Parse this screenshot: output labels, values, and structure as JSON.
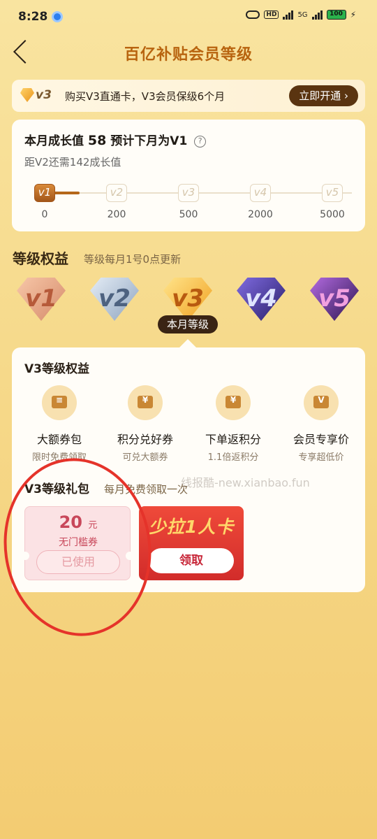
{
  "status_bar": {
    "time": "8:28",
    "hd": "HD",
    "network": "5G",
    "battery": "100"
  },
  "header": {
    "title": "百亿补贴会员等级"
  },
  "promo": {
    "badge": "v3",
    "text": "购买V3直通卡，V3会员保级6个月",
    "button": "立即开通 ›"
  },
  "growth": {
    "title_prefix": "本月成长值",
    "value": "58",
    "title_suffix": "预计下月为V1",
    "subtitle": "距V2还需142成长值",
    "levels": [
      {
        "label": "v1",
        "value": "0"
      },
      {
        "label": "v2",
        "value": "200"
      },
      {
        "label": "v3",
        "value": "500"
      },
      {
        "label": "v4",
        "value": "2000"
      },
      {
        "label": "v5",
        "value": "5000"
      }
    ],
    "progress_fraction": 0.29
  },
  "rights_section": {
    "title": "等级权益",
    "subtitle": "等级每月1号0点更新",
    "gems": [
      "v1",
      "v2",
      "v3",
      "v4",
      "v5"
    ],
    "current_badge": "本月等级"
  },
  "rights_card": {
    "title": "V3等级权益",
    "benefits": [
      {
        "name": "大额券包",
        "sub": "限时免费领取",
        "icon": "coupon-pack-icon"
      },
      {
        "name": "积分兑好券",
        "sub": "可兑大额券",
        "icon": "points-coupon-icon"
      },
      {
        "name": "下单返积分",
        "sub": "1.1倍返积分",
        "icon": "cashback-icon"
      },
      {
        "name": "会员专享价",
        "sub": "专享超低价",
        "icon": "member-price-icon"
      }
    ],
    "gift_title": "V3等级礼包",
    "gift_sub": "每月免费领取一次",
    "watermark": "线报酷-new.xianbao.fun",
    "coupon": {
      "amount": "20",
      "unit": "元",
      "type": "无门槛券",
      "button": "已使用"
    },
    "card2": {
      "text": "少拉1人卡",
      "button": "领取"
    }
  },
  "colors": {
    "accent": "#b8640f",
    "dark_button": "#5a3410",
    "coupon_red": "#c8475a",
    "annotation": "#e5332a"
  }
}
